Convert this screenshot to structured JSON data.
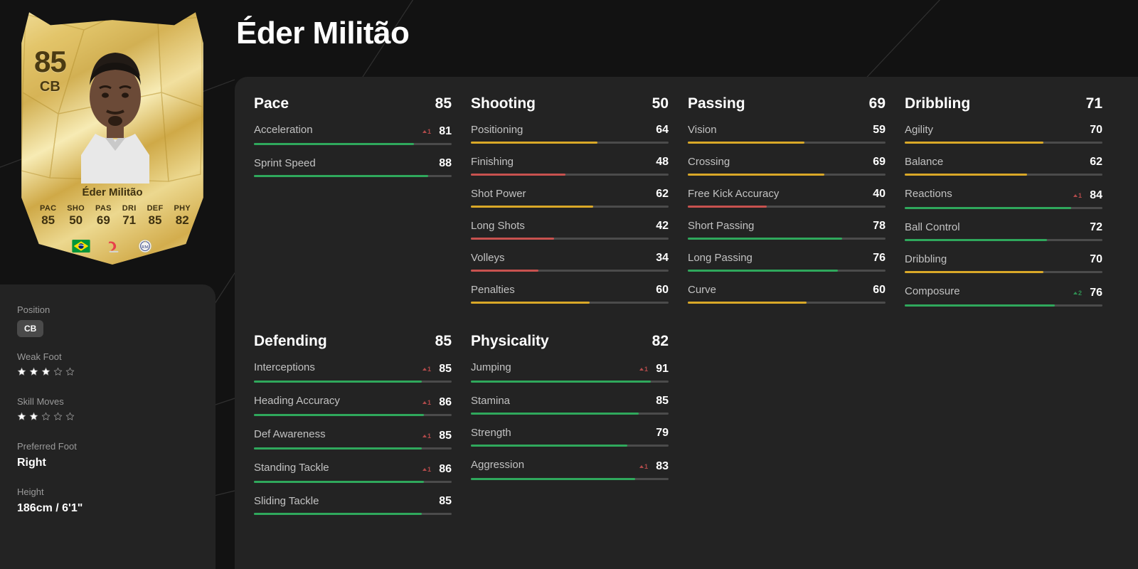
{
  "page": {
    "title": "Éder Militão",
    "background": "#121212",
    "panel_bg": "#232323"
  },
  "card": {
    "rating": "85",
    "position": "CB",
    "name": "Éder Militão",
    "stats": [
      {
        "label": "PAC",
        "value": "85"
      },
      {
        "label": "SHO",
        "value": "50"
      },
      {
        "label": "PAS",
        "value": "69"
      },
      {
        "label": "DRI",
        "value": "71"
      },
      {
        "label": "DEF",
        "value": "85"
      },
      {
        "label": "PHY",
        "value": "82"
      }
    ],
    "badges": [
      {
        "name": "brazil-flag-icon",
        "label": "Brazil"
      },
      {
        "name": "laliga-logo-icon",
        "label": "LaLiga"
      },
      {
        "name": "real-madrid-crest-icon",
        "label": "Real Madrid"
      }
    ]
  },
  "info": {
    "position_label": "Position",
    "position_value": "CB",
    "weak_foot_label": "Weak Foot",
    "weak_foot": 3,
    "skill_moves_label": "Skill Moves",
    "skill_moves": 2,
    "preferred_foot_label": "Preferred Foot",
    "preferred_foot_value": "Right",
    "height_label": "Height",
    "height_value": "186cm / 6'1\"",
    "star_max": 5
  },
  "colors": {
    "green": "#2fa85c",
    "yellow": "#d9a828",
    "red": "#c8524f",
    "track": "#4b4b4b",
    "mod_up": "#b14a4a",
    "mod_up_green": "#2f8f52"
  },
  "stat_groups": [
    {
      "name": "Pace",
      "value": "85",
      "stats": [
        {
          "name": "Acceleration",
          "value": 81,
          "mod": "1",
          "mod_kind": "up",
          "color": "green"
        },
        {
          "name": "Sprint Speed",
          "value": 88,
          "mod": null,
          "mod_kind": null,
          "color": "green"
        }
      ]
    },
    {
      "name": "Shooting",
      "value": "50",
      "stats": [
        {
          "name": "Positioning",
          "value": 64,
          "mod": null,
          "mod_kind": null,
          "color": "yellow"
        },
        {
          "name": "Finishing",
          "value": 48,
          "mod": null,
          "mod_kind": null,
          "color": "red"
        },
        {
          "name": "Shot Power",
          "value": 62,
          "mod": null,
          "mod_kind": null,
          "color": "yellow"
        },
        {
          "name": "Long Shots",
          "value": 42,
          "mod": null,
          "mod_kind": null,
          "color": "red"
        },
        {
          "name": "Volleys",
          "value": 34,
          "mod": null,
          "mod_kind": null,
          "color": "red"
        },
        {
          "name": "Penalties",
          "value": 60,
          "mod": null,
          "mod_kind": null,
          "color": "yellow"
        }
      ]
    },
    {
      "name": "Passing",
      "value": "69",
      "stats": [
        {
          "name": "Vision",
          "value": 59,
          "mod": null,
          "mod_kind": null,
          "color": "yellow"
        },
        {
          "name": "Crossing",
          "value": 69,
          "mod": null,
          "mod_kind": null,
          "color": "yellow"
        },
        {
          "name": "Free Kick Accuracy",
          "value": 40,
          "mod": null,
          "mod_kind": null,
          "color": "red"
        },
        {
          "name": "Short Passing",
          "value": 78,
          "mod": null,
          "mod_kind": null,
          "color": "green"
        },
        {
          "name": "Long Passing",
          "value": 76,
          "mod": null,
          "mod_kind": null,
          "color": "green"
        },
        {
          "name": "Curve",
          "value": 60,
          "mod": null,
          "mod_kind": null,
          "color": "yellow"
        }
      ]
    },
    {
      "name": "Dribbling",
      "value": "71",
      "stats": [
        {
          "name": "Agility",
          "value": 70,
          "mod": null,
          "mod_kind": null,
          "color": "yellow"
        },
        {
          "name": "Balance",
          "value": 62,
          "mod": null,
          "mod_kind": null,
          "color": "yellow"
        },
        {
          "name": "Reactions",
          "value": 84,
          "mod": "1",
          "mod_kind": "up",
          "color": "green"
        },
        {
          "name": "Ball Control",
          "value": 72,
          "mod": null,
          "mod_kind": null,
          "color": "green"
        },
        {
          "name": "Dribbling",
          "value": 70,
          "mod": null,
          "mod_kind": null,
          "color": "yellow"
        },
        {
          "name": "Composure",
          "value": 76,
          "mod": "2",
          "mod_kind": "up2",
          "color": "green"
        }
      ]
    },
    {
      "name": "Defending",
      "value": "85",
      "stats": [
        {
          "name": "Interceptions",
          "value": 85,
          "mod": "1",
          "mod_kind": "up",
          "color": "green"
        },
        {
          "name": "Heading Accuracy",
          "value": 86,
          "mod": "1",
          "mod_kind": "up",
          "color": "green"
        },
        {
          "name": "Def Awareness",
          "value": 85,
          "mod": "1",
          "mod_kind": "up",
          "color": "green"
        },
        {
          "name": "Standing Tackle",
          "value": 86,
          "mod": "1",
          "mod_kind": "up",
          "color": "green"
        },
        {
          "name": "Sliding Tackle",
          "value": 85,
          "mod": null,
          "mod_kind": null,
          "color": "green"
        }
      ]
    },
    {
      "name": "Physicality",
      "value": "82",
      "stats": [
        {
          "name": "Jumping",
          "value": 91,
          "mod": "1",
          "mod_kind": "up",
          "color": "green"
        },
        {
          "name": "Stamina",
          "value": 85,
          "mod": null,
          "mod_kind": null,
          "color": "green"
        },
        {
          "name": "Strength",
          "value": 79,
          "mod": null,
          "mod_kind": null,
          "color": "green"
        },
        {
          "name": "Aggression",
          "value": 83,
          "mod": "1",
          "mod_kind": "up",
          "color": "green"
        }
      ]
    }
  ]
}
